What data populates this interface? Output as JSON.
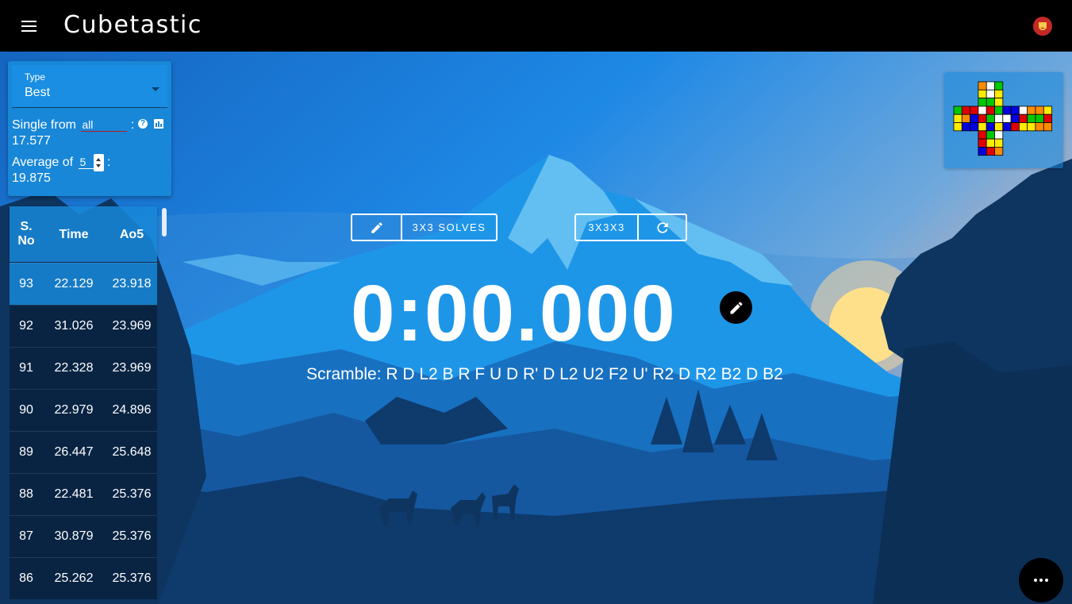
{
  "app": {
    "title": "Cubetastic"
  },
  "stats": {
    "type_label": "Type",
    "type_value": "Best",
    "single_prefix": "Single from",
    "single_scope": "all",
    "single_value": "17.577",
    "average_prefix": "Average of",
    "average_n": "5",
    "average_value": "19.875",
    "colon": ":"
  },
  "table": {
    "headers": {
      "sno_line1": "S.",
      "sno_line2": "No",
      "time": "Time",
      "ao5": "Ao5"
    },
    "rows": [
      {
        "sno": "93",
        "time": "22.129",
        "ao5": "23.918"
      },
      {
        "sno": "92",
        "time": "31.026",
        "ao5": "23.969"
      },
      {
        "sno": "91",
        "time": "22.328",
        "ao5": "23.969"
      },
      {
        "sno": "90",
        "time": "22.979",
        "ao5": "24.896"
      },
      {
        "sno": "89",
        "time": "26.447",
        "ao5": "25.648"
      },
      {
        "sno": "88",
        "time": "22.481",
        "ao5": "25.376"
      },
      {
        "sno": "87",
        "time": "30.879",
        "ao5": "25.376"
      },
      {
        "sno": "86",
        "time": "25.262",
        "ao5": "25.376"
      }
    ]
  },
  "controls": {
    "session_label": "3X3 SOLVES",
    "puzzle_label": "3X3X3"
  },
  "timer": {
    "display": "0:00.000"
  },
  "scramble": {
    "text": "Scramble: R D L2 B R F U D R' D L2 U2 F2 U' R2 D R2 B2 D B2"
  },
  "cube": {
    "colors": {
      "W": "#ffffff",
      "Y": "#ffeb00",
      "G": "#00c800",
      "B": "#0000e0",
      "R": "#e00000",
      "O": "#ff8c00"
    },
    "faces": {
      "U": [
        "O",
        "W",
        "G",
        "Y",
        "W",
        "Y",
        "G",
        "G",
        "Y"
      ],
      "L": [
        "G",
        "R",
        "R",
        "Y",
        "O",
        "B",
        "Y",
        "B",
        "B"
      ],
      "F": [
        "W",
        "R",
        "G",
        "R",
        "G",
        "W",
        "Y",
        "B",
        "Y"
      ],
      "R": [
        "B",
        "B",
        "W",
        "W",
        "B",
        "R",
        "B",
        "R",
        "Y"
      ],
      "B": [
        "O",
        "O",
        "Y",
        "G",
        "G",
        "R",
        "Y",
        "O",
        "O"
      ],
      "D": [
        "R",
        "G",
        "W",
        "R",
        "Y",
        "Y",
        "B",
        "R",
        "O"
      ]
    }
  },
  "icons": {
    "menu": "menu-icon",
    "avatar": "iron-man-icon",
    "help": "help-icon",
    "chart": "chart-icon",
    "edit": "pencil-icon",
    "refresh": "refresh-icon",
    "more": "more-horiz-icon"
  }
}
